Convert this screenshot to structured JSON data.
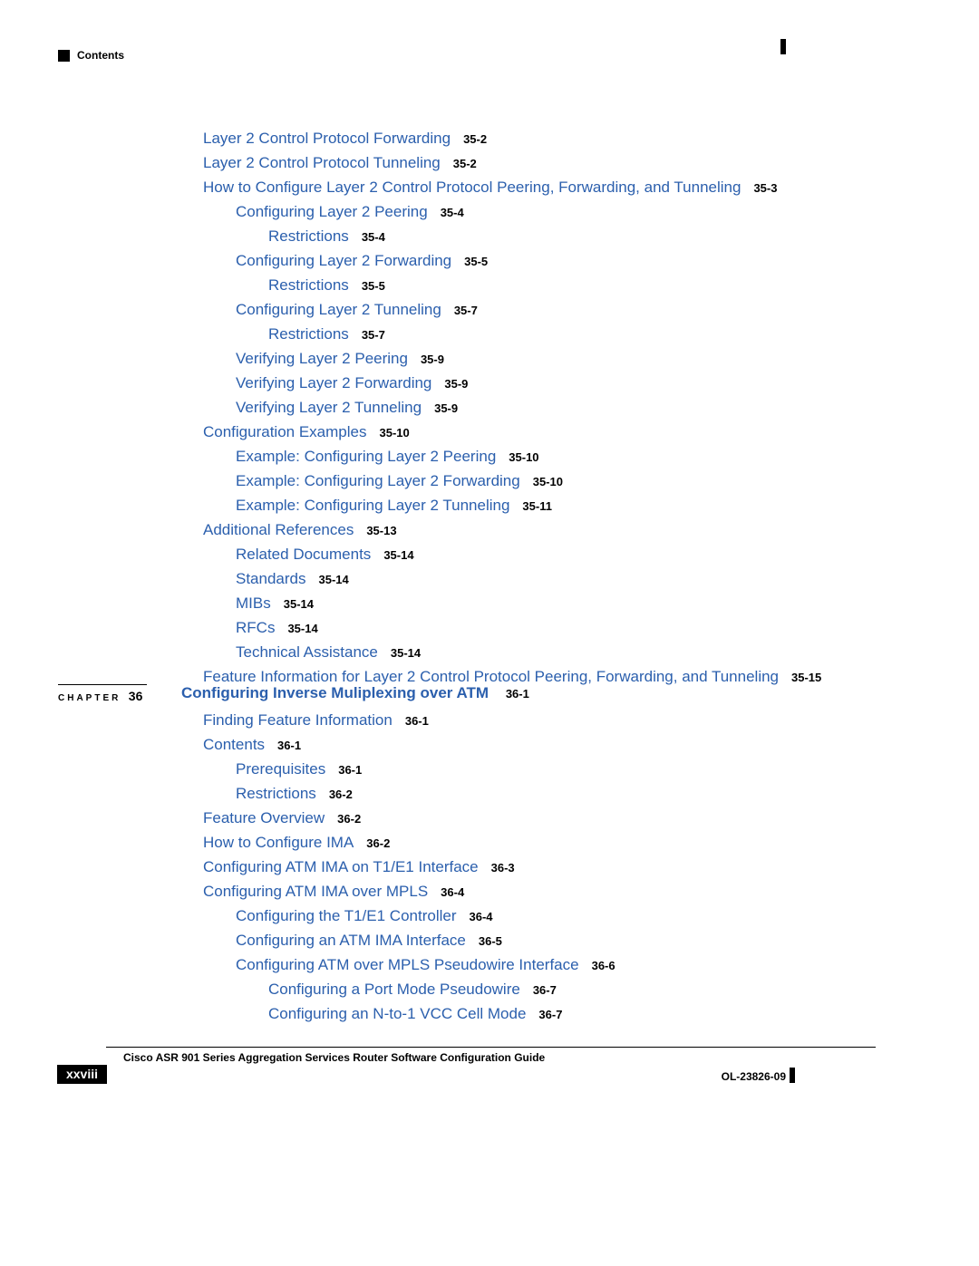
{
  "header": {
    "label": "Contents"
  },
  "toc1": [
    {
      "indent": "i1",
      "text": "Layer 2 Control Protocol Forwarding",
      "page": "35-2"
    },
    {
      "indent": "i1",
      "text": "Layer 2 Control Protocol Tunneling",
      "page": "35-2"
    },
    {
      "indent": "i1",
      "text": "How to Configure Layer 2 Control Protocol Peering, Forwarding, and Tunneling",
      "page": "35-3"
    },
    {
      "indent": "i2",
      "text": "Configuring Layer 2 Peering",
      "page": "35-4"
    },
    {
      "indent": "i3",
      "text": "Restrictions",
      "page": "35-4"
    },
    {
      "indent": "i2",
      "text": "Configuring Layer 2 Forwarding",
      "page": "35-5"
    },
    {
      "indent": "i3",
      "text": "Restrictions",
      "page": "35-5"
    },
    {
      "indent": "i2",
      "text": "Configuring Layer 2 Tunneling",
      "page": "35-7"
    },
    {
      "indent": "i3",
      "text": "Restrictions",
      "page": "35-7"
    },
    {
      "indent": "i2",
      "text": "Verifying Layer 2 Peering",
      "page": "35-9"
    },
    {
      "indent": "i2",
      "text": "Verifying Layer 2 Forwarding",
      "page": "35-9"
    },
    {
      "indent": "i2",
      "text": "Verifying Layer 2 Tunneling",
      "page": "35-9"
    },
    {
      "indent": "i1",
      "text": "Configuration Examples",
      "page": "35-10"
    },
    {
      "indent": "i2",
      "text": "Example: Configuring Layer 2 Peering",
      "page": "35-10"
    },
    {
      "indent": "i2",
      "text": "Example: Configuring Layer 2 Forwarding",
      "page": "35-10"
    },
    {
      "indent": "i2",
      "text": "Example: Configuring Layer 2 Tunneling",
      "page": "35-11"
    },
    {
      "indent": "i1",
      "text": "Additional References",
      "page": "35-13"
    },
    {
      "indent": "i2",
      "text": "Related Documents",
      "page": "35-14"
    },
    {
      "indent": "i2",
      "text": "Standards",
      "page": "35-14"
    },
    {
      "indent": "i2",
      "text": "MIBs",
      "page": "35-14"
    },
    {
      "indent": "i2",
      "text": "RFCs",
      "page": "35-14"
    },
    {
      "indent": "i2",
      "text": "Technical Assistance",
      "page": "35-14"
    },
    {
      "indent": "i1",
      "text": "Feature Information for Layer 2 Control Protocol Peering, Forwarding, and Tunneling",
      "page": "35-15"
    }
  ],
  "chapter": {
    "label": "CHAPTER",
    "num": "36",
    "title": "Configuring Inverse Muliplexing over ATM",
    "page": "36-1"
  },
  "toc2": [
    {
      "indent": "i1",
      "text": "Finding Feature Information",
      "page": "36-1"
    },
    {
      "indent": "i1",
      "text": "Contents",
      "page": "36-1"
    },
    {
      "indent": "i2",
      "text": "Prerequisites",
      "page": "36-1"
    },
    {
      "indent": "i2",
      "text": "Restrictions",
      "page": "36-2"
    },
    {
      "indent": "i1",
      "text": "Feature Overview",
      "page": "36-2"
    },
    {
      "indent": "i1",
      "text": "How to Configure IMA",
      "page": "36-2"
    },
    {
      "indent": "i1",
      "text": "Configuring ATM IMA on T1/E1 Interface",
      "page": "36-3"
    },
    {
      "indent": "i1",
      "text": "Configuring ATM IMA over MPLS",
      "page": "36-4"
    },
    {
      "indent": "i2",
      "text": "Configuring the T1/E1 Controller",
      "page": "36-4"
    },
    {
      "indent": "i2",
      "text": "Configuring an ATM IMA Interface",
      "page": "36-5"
    },
    {
      "indent": "i2",
      "text": "Configuring ATM over MPLS Pseudowire Interface",
      "page": "36-6"
    },
    {
      "indent": "i3",
      "text": "Configuring a Port Mode Pseudowire",
      "page": "36-7"
    },
    {
      "indent": "i3",
      "text": "Configuring an N-to-1 VCC Cell Mode",
      "page": "36-7"
    }
  ],
  "footer": {
    "title": "Cisco ASR 901 Series Aggregation Services Router Software Configuration Guide",
    "pagenum": "xxviii",
    "docnum": "OL-23826-09"
  }
}
